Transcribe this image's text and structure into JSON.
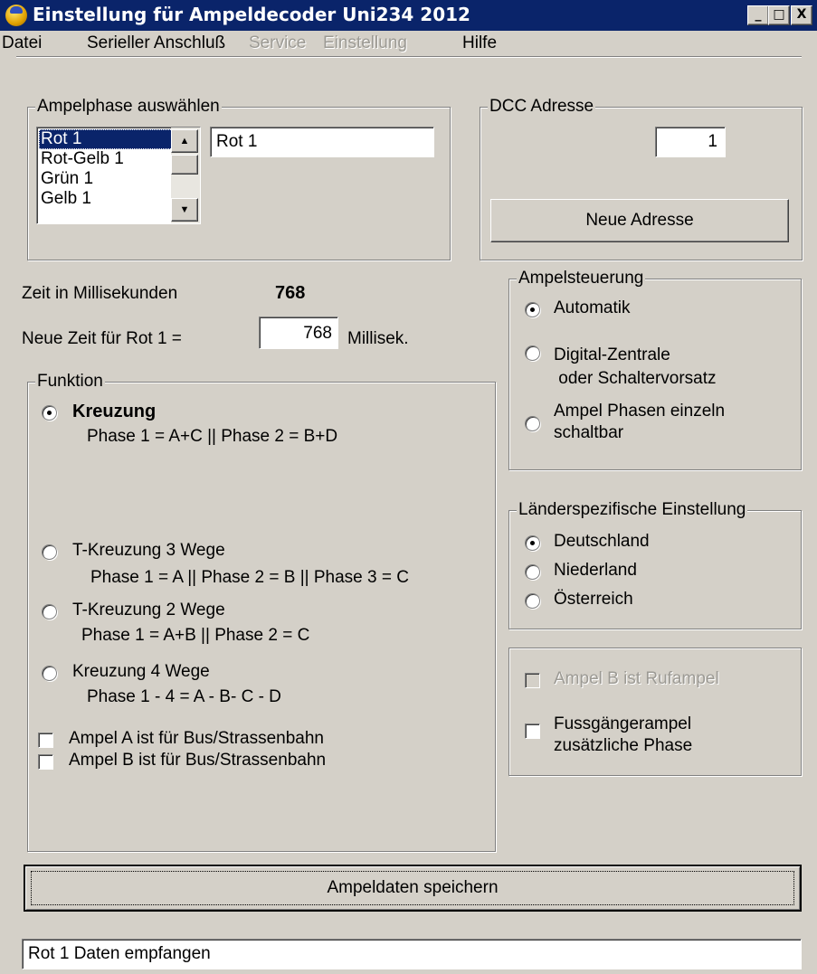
{
  "window": {
    "title": "Einstellung für Ampeldecoder Uni234 2012",
    "icon": "app-icon",
    "controls": {
      "minimize": "_",
      "maximize": "□",
      "close": "X"
    }
  },
  "menu": [
    "Datei",
    "Serieller Anschluß",
    "Service",
    "Einstellung",
    "Hilfe"
  ],
  "menu_disabled": [
    "Service",
    "Einstellung"
  ],
  "phase_group": {
    "legend": "Ampelphase auswählen",
    "list": [
      "Rot 1",
      "Rot-Gelb 1",
      "Grün 1",
      "Gelb 1"
    ],
    "selected": "Rot 1",
    "name_field": "Rot 1"
  },
  "dcc_group": {
    "legend": "DCC Adresse",
    "address": "1",
    "new_address_button": "Neue Adresse"
  },
  "time": {
    "label": "Zeit in Millisekunden",
    "value": "768",
    "new_label": "Neue Zeit für Rot 1 =",
    "new_value": "768",
    "unit": "Millisek."
  },
  "funktion_group": {
    "legend": "Funktion",
    "options": [
      {
        "label": "Kreuzung",
        "detail": "Phase 1 = A+C || Phase 2 =  B+D",
        "selected": true
      },
      {
        "label": "T-Kreuzung 3 Wege",
        "detail": "Phase 1 = A || Phase 2 = B || Phase 3 = C",
        "selected": false
      },
      {
        "label": "T-Kreuzung 2 Wege",
        "detail": "Phase 1 = A+B || Phase 2 = C",
        "selected": false
      },
      {
        "label": "Kreuzung 4 Wege",
        "detail": "Phase 1 - 4 = A - B- C - D",
        "selected": false
      }
    ],
    "checks": [
      {
        "label": "Ampel A ist für Bus/Strassenbahn",
        "checked": false
      },
      {
        "label": "Ampel B ist für Bus/Strassenbahn",
        "checked": false
      }
    ]
  },
  "ampelsteuerung_group": {
    "legend": "Ampelsteuerung",
    "options": [
      {
        "line1": "Automatik",
        "line2": "",
        "selected": true
      },
      {
        "line1": "Digital-Zentrale",
        "line2": " oder Schaltervorsatz",
        "selected": false
      },
      {
        "line1": "Ampel Phasen einzeln",
        "line2": "schaltbar",
        "selected": false
      }
    ]
  },
  "laender_group": {
    "legend": "Länderspezifische Einstellung",
    "options": [
      {
        "label": "Deutschland",
        "selected": true
      },
      {
        "label": "Niederland",
        "selected": false
      },
      {
        "label": "Österreich",
        "selected": false
      }
    ]
  },
  "extra_group": {
    "checks": [
      {
        "line1": "Ampel B ist Rufampel",
        "line2": "",
        "checked": false,
        "disabled": true
      },
      {
        "line1": "Fussgängerampel",
        "line2": "zusätzliche Phase",
        "checked": false,
        "disabled": false
      }
    ]
  },
  "save_button": "Ampeldaten speichern",
  "status": "Rot 1 Daten empfangen"
}
